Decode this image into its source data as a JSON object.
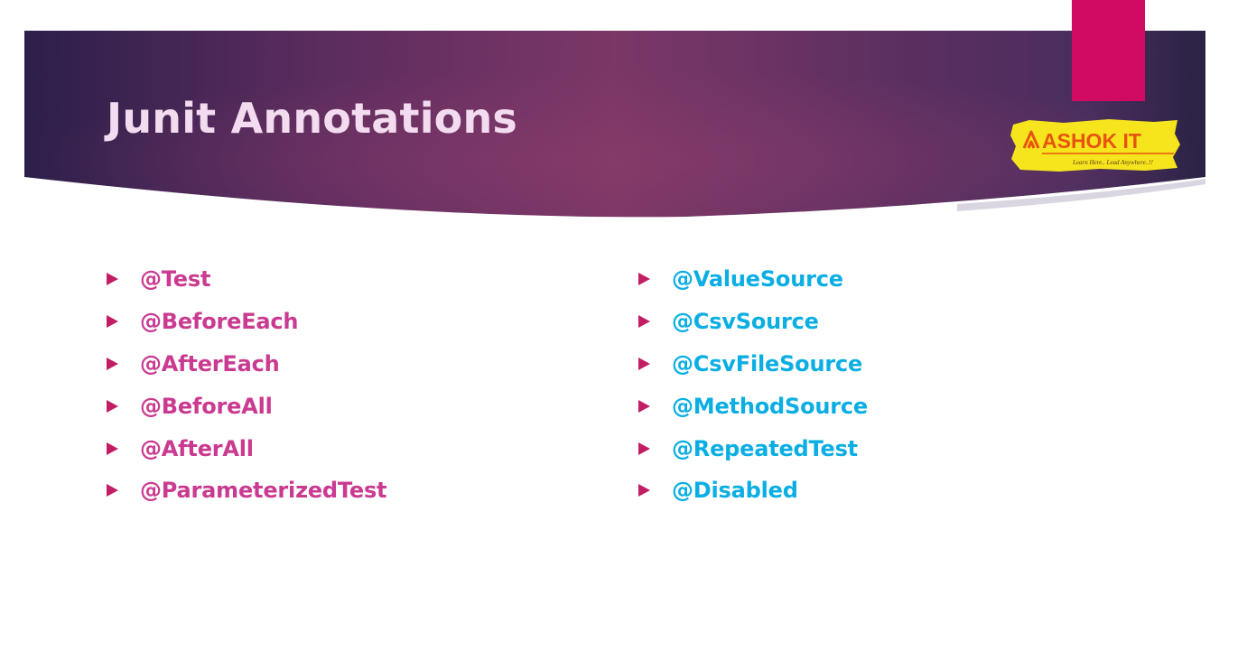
{
  "slide": {
    "title": "Junit Annotations",
    "logo": {
      "brand": "ASHOK IT",
      "tagline": "Learn Here.. Lead Anywhere..!!"
    }
  },
  "colors": {
    "banner_dark": "#2c1f4a",
    "banner_mid": "#7b3766",
    "accent_bar": "#d10a63",
    "title_text": "#f3dcef",
    "bullet": "#c21e63",
    "left_items": "#c93a90",
    "right_items": "#0aaee3",
    "logo_yellow": "#f6e51c",
    "logo_orange": "#e8540f"
  },
  "left_column": [
    "@Test",
    "@BeforeEach",
    "@AfterEach",
    "@BeforeAll",
    "@AfterAll",
    "@ParameterizedTest"
  ],
  "right_column": [
    "@ValueSource",
    "@CsvSource",
    "@CsvFileSource",
    "@MethodSource",
    "@RepeatedTest",
    "@Disabled"
  ]
}
